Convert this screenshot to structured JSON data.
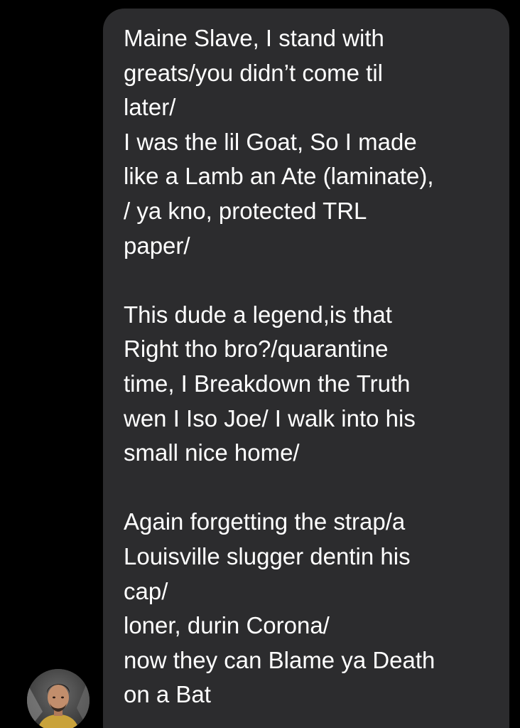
{
  "conversation": {
    "message": {
      "text": "Maine Slave, I stand with\ngreats/you didn’t come til\nlater/\nI was the lil Goat, So I made\nlike a Lamb an Ate (laminate),\n/ ya kno, protected TRL\npaper/\n\nThis dude a legend,is that\nRight tho bro?/quarantine\ntime, I Breakdown the Truth\nwen I Iso Joe/ I walk into his\nsmall nice home/\n\nAgain forgetting the strap/a\nLouisville slugger dentin his\ncap/\nloner, durin Corona/\nnow they can Blame ya Death\non a Bat"
    },
    "sender": {
      "avatar_icon": "user-photo-avatar"
    }
  },
  "colors": {
    "background": "#000000",
    "bubble": "#2c2c2e",
    "text": "#ffffff"
  }
}
